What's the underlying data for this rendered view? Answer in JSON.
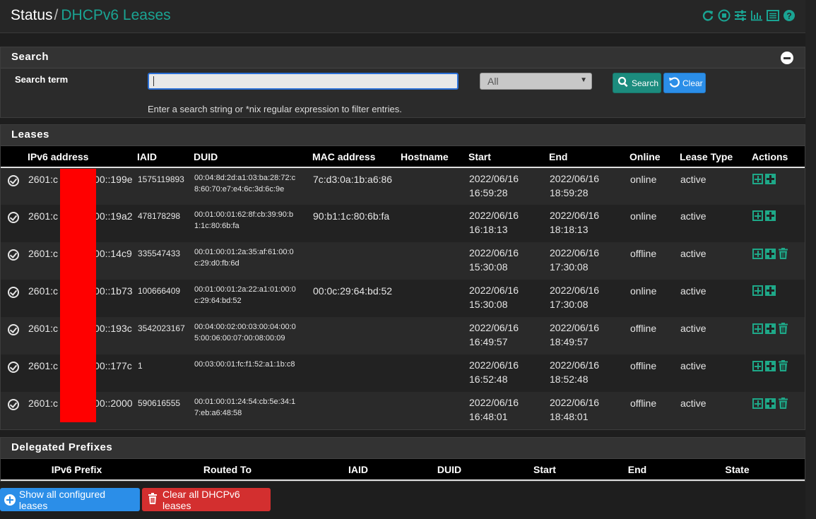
{
  "breadcrumb": {
    "root": "Status",
    "separator": "/",
    "current": "DHCPv6 Leases"
  },
  "top_icons": [
    "reload-icon",
    "stop-icon",
    "sliders-icon",
    "bar-chart-icon",
    "list-icon",
    "help-icon"
  ],
  "colors": {
    "accent": "#1aa493",
    "primary_button": "#2b8ee8",
    "danger_button": "#d32f2f",
    "redaction": "#ff0000"
  },
  "search": {
    "title": "Search",
    "label": "Search term",
    "input_value": "",
    "select_value": "All",
    "search_button": "Search",
    "clear_button": "Clear",
    "help_text": "Enter a search string or *nix regular expression to filter entries."
  },
  "leases": {
    "title": "Leases",
    "columns": [
      "IPv6 address",
      "IAID",
      "DUID",
      "MAC address",
      "Hostname",
      "Start",
      "End",
      "Online",
      "Lease Type",
      "Actions"
    ],
    "rows": [
      {
        "ip": "2601:c",
        "ip_suffix": "00::199e",
        "iaid": "1575119893",
        "duid1": "00:04:8d:2d:a1:03:ba:28:72:c",
        "duid2": "8:60:70:e7:e4:6c:3d:6c:9e",
        "mac": "7c:d3:0a:1b:a6:86",
        "hostname": "",
        "start_date": "2022/06/16",
        "start_time": "16:59:28",
        "end_date": "2022/06/16",
        "end_time": "18:59:28",
        "online": "online",
        "type": "active",
        "deletable": false
      },
      {
        "ip": "2601:c",
        "ip_suffix": "00::19a2",
        "iaid": "478178298",
        "duid1": "00:01:00:01:62:8f:cb:39:90:b",
        "duid2": "1:1c:80:6b:fa",
        "mac": "90:b1:1c:80:6b:fa",
        "hostname": "",
        "start_date": "2022/06/16",
        "start_time": "16:18:13",
        "end_date": "2022/06/16",
        "end_time": "18:18:13",
        "online": "online",
        "type": "active",
        "deletable": false
      },
      {
        "ip": "2601:c",
        "ip_suffix": "00::14c9",
        "iaid": "335547433",
        "duid1": "00:01:00:01:2a:35:af:61:00:0",
        "duid2": "c:29:d0:fb:6d",
        "mac": "",
        "hostname": "",
        "start_date": "2022/06/16",
        "start_time": "15:30:08",
        "end_date": "2022/06/16",
        "end_time": "17:30:08",
        "online": "offline",
        "type": "active",
        "deletable": true
      },
      {
        "ip": "2601:c",
        "ip_suffix": "00::1b73",
        "iaid": "100666409",
        "duid1": "00:01:00:01:2a:22:a1:01:00:0",
        "duid2": "c:29:64:bd:52",
        "mac": "00:0c:29:64:bd:52",
        "hostname": "",
        "start_date": "2022/06/16",
        "start_time": "15:30:08",
        "end_date": "2022/06/16",
        "end_time": "17:30:08",
        "online": "online",
        "type": "active",
        "deletable": false
      },
      {
        "ip": "2601:c",
        "ip_suffix": "00::193c",
        "iaid": "3542023167",
        "duid1": "00:04:00:02:00:03:00:04:00:0",
        "duid2": "5:00:06:00:07:00:08:00:09",
        "mac": "",
        "hostname": "",
        "start_date": "2022/06/16",
        "start_time": "16:49:57",
        "end_date": "2022/06/16",
        "end_time": "18:49:57",
        "online": "offline",
        "type": "active",
        "deletable": true
      },
      {
        "ip": "2601:c",
        "ip_suffix": "00::177c",
        "iaid": "1",
        "duid1": "00:03:00:01:fc:f1:52:a1:1b:c8",
        "duid2": "",
        "mac": "",
        "hostname": "",
        "start_date": "2022/06/16",
        "start_time": "16:52:48",
        "end_date": "2022/06/16",
        "end_time": "18:52:48",
        "online": "offline",
        "type": "active",
        "deletable": true
      },
      {
        "ip": "2601:c",
        "ip_suffix": "00::2000",
        "iaid": "590616555",
        "duid1": "00:01:00:01:24:54:cb:5e:34:1",
        "duid2": "7:eb:a6:48:58",
        "mac": "",
        "hostname": "",
        "start_date": "2022/06/16",
        "start_time": "16:48:01",
        "end_date": "2022/06/16",
        "end_time": "18:48:01",
        "online": "offline",
        "type": "active",
        "deletable": true
      }
    ]
  },
  "delegated": {
    "title": "Delegated Prefixes",
    "columns": [
      "IPv6 Prefix",
      "Routed To",
      "IAID",
      "DUID",
      "Start",
      "End",
      "State"
    ]
  },
  "buttons": {
    "show_all": "Show all configured leases",
    "clear_all": "Clear all DHCPv6 leases"
  }
}
